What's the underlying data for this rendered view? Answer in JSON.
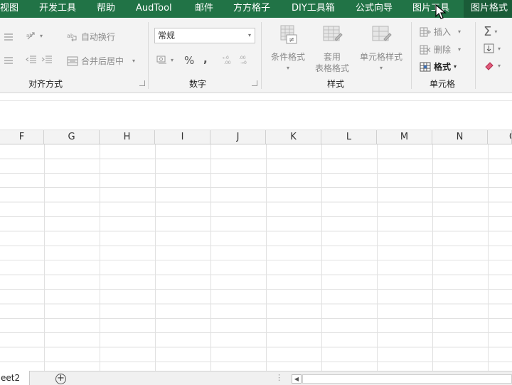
{
  "menu": {
    "items": [
      "视图",
      "开发工具",
      "帮助",
      "AudTool",
      "邮件",
      "方方格子",
      "DIY工具箱",
      "公式向导",
      "图片工具",
      "图片格式"
    ]
  },
  "ribbon": {
    "alignment": {
      "wrap_text": "自动换行",
      "merge_center": "合并后居中",
      "label": "对齐方式"
    },
    "number": {
      "format_value": "常规",
      "percent": "%",
      "comma": ",",
      "label": "数字"
    },
    "styles": {
      "conditional_format": "条件格式",
      "table_format_line1": "套用",
      "table_format_line2": "表格格式",
      "cell_styles": "单元格样式",
      "label": "样式"
    },
    "cells": {
      "insert": "插入",
      "delete": "删除",
      "format": "格式",
      "label": "单元格"
    }
  },
  "grid": {
    "columns": [
      "F",
      "G",
      "H",
      "I",
      "J",
      "K",
      "L",
      "M",
      "N",
      "O"
    ]
  },
  "footer": {
    "sheet_tab": "eet2",
    "add_sheet": "+",
    "dots": "⋮"
  },
  "colors": {
    "menubar": "#217346",
    "ribbon": "#f3f3f3"
  }
}
